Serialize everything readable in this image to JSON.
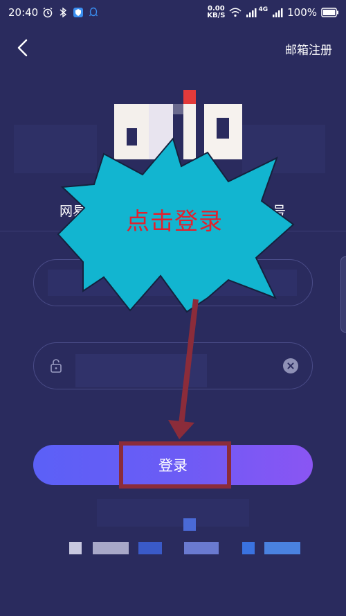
{
  "status_bar": {
    "time": "20:40",
    "network_speed_value": "0.00",
    "network_speed_unit": "KB/S",
    "signal_label": "4G",
    "battery": "100%"
  },
  "nav": {
    "back_icon": "chevron-left-icon",
    "email_register_label": "邮箱注册"
  },
  "subtitle": {
    "left_fragment": "网易",
    "right_fragment": "号"
  },
  "form": {
    "password_icon": "lock-icon",
    "clear_icon": "clear-icon"
  },
  "login": {
    "button_label": "登录"
  },
  "annotation": {
    "callout_text": "点击登录",
    "callout_color": "#12b5d0",
    "text_color": "#e3202c",
    "arrow_color": "#8b2c3a"
  },
  "colors": {
    "background": "#2a2b5e",
    "button_gradient_start": "#5b60f7",
    "button_gradient_end": "#8a55f3"
  }
}
